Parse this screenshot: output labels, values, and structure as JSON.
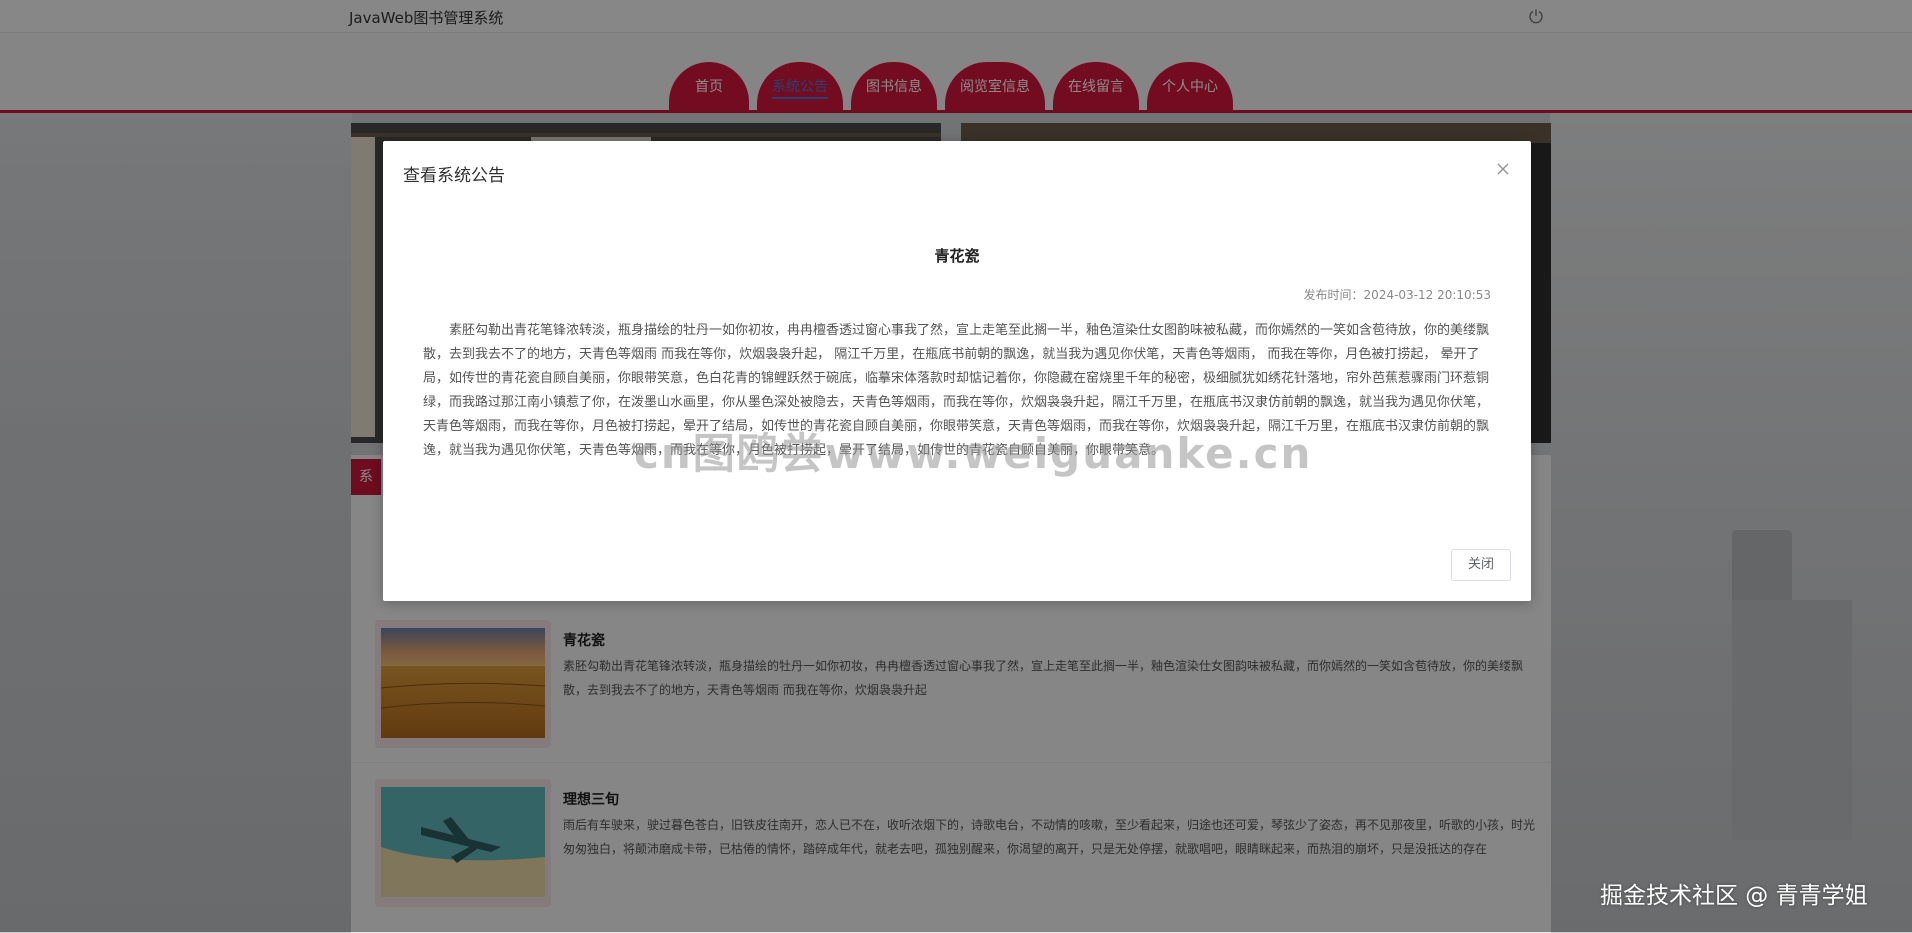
{
  "app": {
    "title": "JavaWeb图书管理系统"
  },
  "nav": {
    "tabs": [
      {
        "label": "首页"
      },
      {
        "label": "系统公告",
        "active": true
      },
      {
        "label": "图书信息"
      },
      {
        "label": "阅览室信息"
      },
      {
        "label": "在线留言"
      },
      {
        "label": "个人中心"
      }
    ]
  },
  "section": {
    "tab_label": "系"
  },
  "news": [
    {
      "title": "青花瓷",
      "summary": "素胚勾勒出青花笔锋浓转淡，瓶身描绘的牡丹一如你初妆，冉冉檀香透过窗心事我了然，宣上走笔至此搁一半，釉色渲染仕女图韵味被私藏，而你嫣然的一笑如含苞待放，你的美缕飘散，去到我去不了的地方，天青色等烟雨 而我在等你，炊烟袅袅升起",
      "thumb_icon": "wheat-field-image"
    },
    {
      "title": "理想三旬",
      "summary": "雨后有车驶来，驶过暮色苍白，旧铁皮往南开，恋人已不在，收听浓烟下的，诗歌电台，不动情的咳嗽，至少看起来，归途也还可爱，琴弦少了姿态，再不见那夜里，听歌的小孩，时光匆匆独白，将颠沛磨成卡带，已枯倦的情怀，踏碎成年代，就老去吧，孤独别醒来，你渴望的离开，只是无处停摆，就歌唱吧，眼睛眯起来，而热泪的崩坏，只是没抵达的存在",
      "thumb_icon": "airplane-over-beach-image"
    }
  ],
  "modal": {
    "title": "查看系统公告",
    "notice_title": "青花瓷",
    "publish_time": "发布时间：2024-03-12 20:10:53",
    "body": "素胚勾勒出青花笔锋浓转淡，瓶身描绘的牡丹一如你初妆，冉冉檀香透过窗心事我了然，宣上走笔至此搁一半，釉色渲染仕女图韵味被私藏，而你嫣然的一笑如含苞待放，你的美缕飘散，去到我去不了的地方，天青色等烟雨 而我在等你，炊烟袅袅升起， 隔江千万里，在瓶底书前朝的飘逸，就当我为遇见你伏笔，天青色等烟雨， 而我在等你，月色被打捞起， 晕开了局，如传世的青花瓷自顾自美丽，你眼带笑意，色白花青的锦鲤跃然于碗底，临摹宋体落款时却惦记着你，你隐藏在窑烧里千年的秘密，极细腻犹如绣花针落地，帘外芭蕉惹骤雨门环惹铜绿，而我路过那江南小镇惹了你，在泼墨山水画里，你从墨色深处被隐去，天青色等烟雨，而我在等你，炊烟袅袅升起，隔江千万里，在瓶底书汉隶仿前朝的飘逸，就当我为遇见你伏笔，天青色等烟雨，而我在等你，月色被打捞起，晕开了结局，如传世的青花瓷自顾自美丽，你眼带笑意，天青色等烟雨，而我在等你，炊烟袅袅升起，隔江千万里，在瓶底书汉隶仿前朝的飘逸，就当我为遇见你伏笔，天青色等烟雨，而我在等你，月色被打捞起，晕开了结局，如传世的青花瓷自顾自美丽，你眼带笑意。",
    "close_label": "关闭"
  },
  "watermarks": {
    "center": "cn图鸥尝www.weiguanke.cn",
    "corner": "掘金技术社区 @ 青青学姐"
  },
  "colors": {
    "accent": "#d1163c",
    "active_text": "#4a78d6",
    "overlay": "rgba(0,0,0,0.45)"
  },
  "icons": {
    "power": "power-icon",
    "close": "close-icon"
  }
}
